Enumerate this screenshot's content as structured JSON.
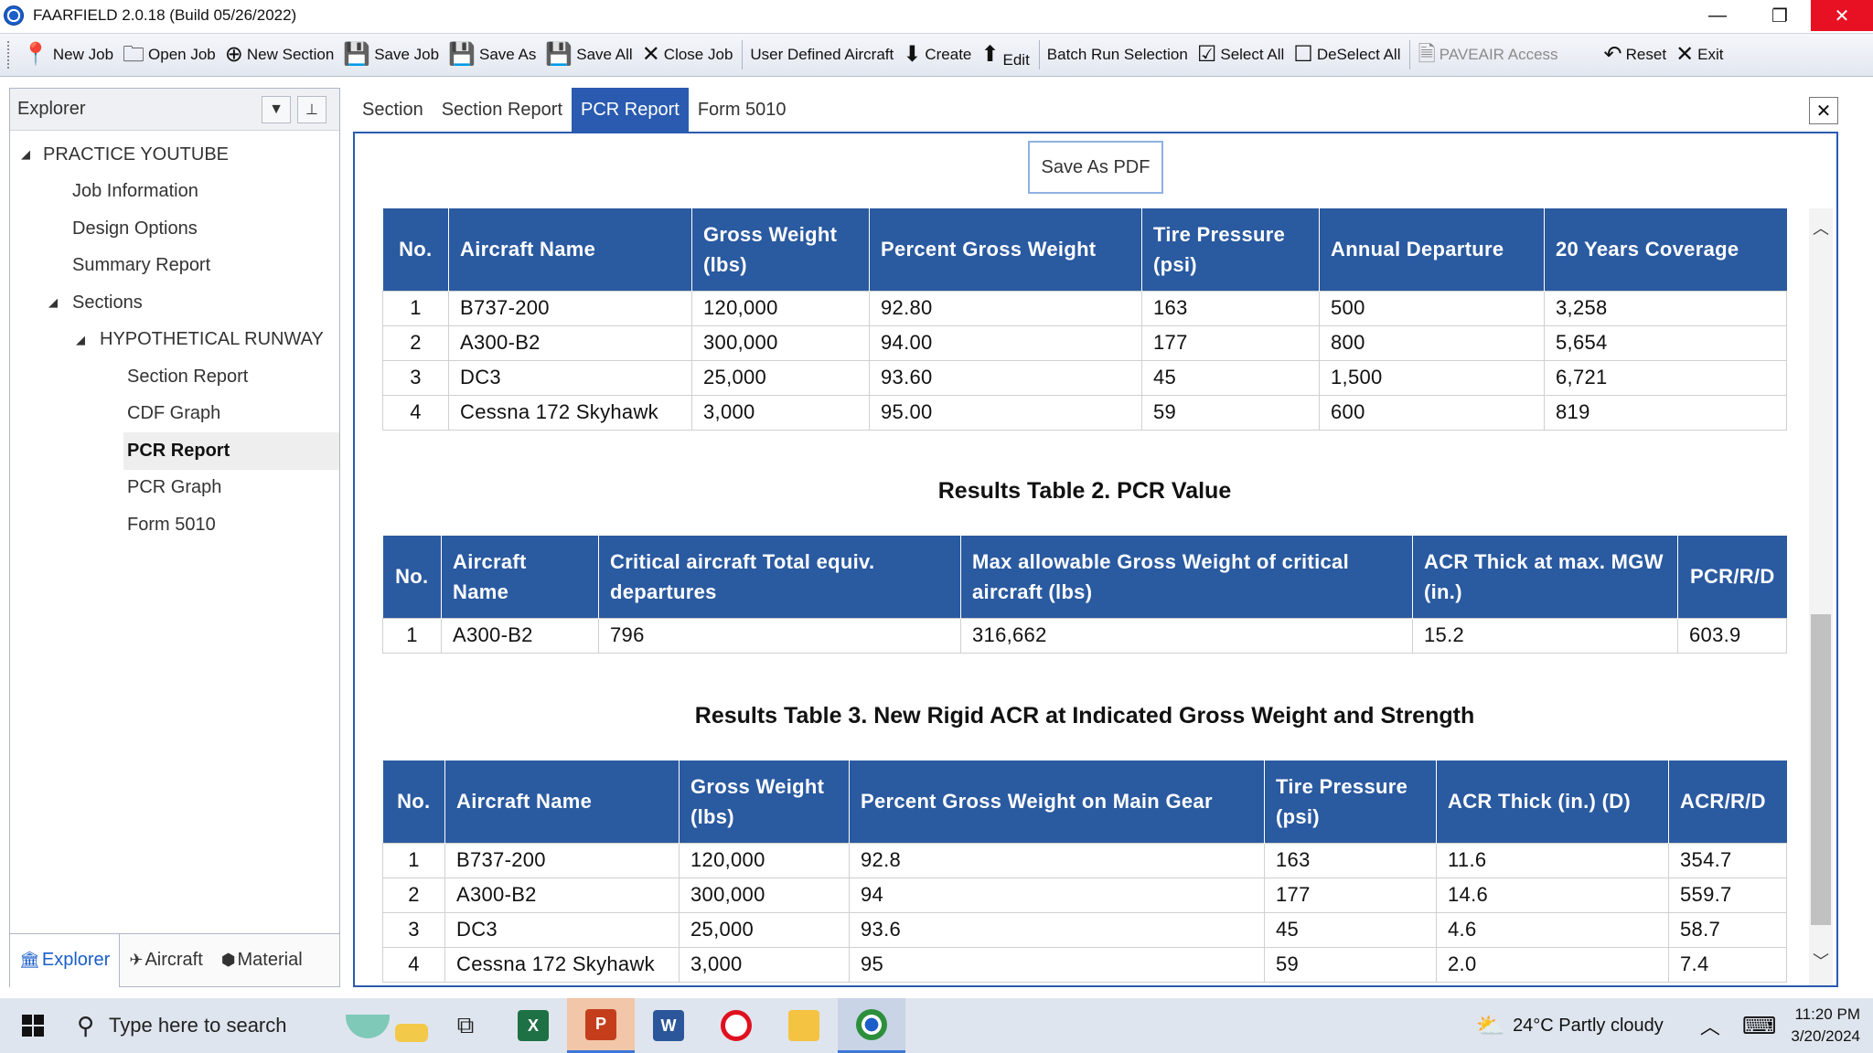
{
  "window": {
    "title": "FAARFIELD 2.0.18 (Build 05/26/2022)",
    "minimize": "—",
    "restore": "❐",
    "close": "✕"
  },
  "toolbar": {
    "new_job": "New Job",
    "open_job": "Open Job",
    "new_section": "New Section",
    "save_job": "Save Job",
    "save_as": "Save As",
    "save_all": "Save All",
    "close_job": "Close Job",
    "user_defined_aircraft": "User Defined Aircraft",
    "create": "Create",
    "edit": "Edit",
    "batch_run_selection": "Batch Run Selection",
    "select_all": "Select All",
    "deselect_all": "DeSelect All",
    "paveair_access": "PAVEAIR Access",
    "reset": "Reset",
    "exit": "Exit"
  },
  "explorer": {
    "title": "Explorer",
    "tree": {
      "root": "PRACTICE YOUTUBE",
      "job_information": "Job Information",
      "design_options": "Design Options",
      "summary_report": "Summary Report",
      "sections": "Sections",
      "runway": "HYPOTHETICAL RUNWAY",
      "section_report": "Section Report",
      "cdf_graph": "CDF Graph",
      "pcr_report": "PCR Report",
      "pcr_graph": "PCR Graph",
      "form_5010": "Form 5010"
    },
    "bottom_tabs": {
      "explorer": "Explorer",
      "aircraft": "Aircraft",
      "material": "Material"
    }
  },
  "tabs": {
    "section": "Section",
    "section_report": "Section Report",
    "pcr_report": "PCR Report",
    "form_5010": "Form 5010"
  },
  "report": {
    "save_pdf": "Save As PDF",
    "table1": {
      "headers": [
        "No.",
        "Aircraft Name",
        "Gross Weight (lbs)",
        "Percent Gross Weight",
        "Tire Pressure (psi)",
        "Annual Departure",
        "20 Years Coverage"
      ],
      "rows": [
        [
          "1",
          "B737-200",
          "120,000",
          "92.80",
          "163",
          "500",
          "3,258"
        ],
        [
          "2",
          "A300-B2",
          "300,000",
          "94.00",
          "177",
          "800",
          "5,654"
        ],
        [
          "3",
          "DC3",
          "25,000",
          "93.60",
          "45",
          "1,500",
          "6,721"
        ],
        [
          "4",
          "Cessna 172 Skyhawk",
          "3,000",
          "95.00",
          "59",
          "600",
          "819"
        ]
      ]
    },
    "table2": {
      "title": "Results Table 2. PCR Value",
      "headers": [
        "No.",
        "Aircraft Name",
        "Critical aircraft Total equiv. departures",
        "Max allowable Gross Weight of critical aircraft (lbs)",
        "ACR Thick at max. MGW (in.)",
        "PCR/R/D"
      ],
      "rows": [
        [
          "1",
          "A300-B2",
          "796",
          "316,662",
          "15.2",
          "603.9"
        ]
      ]
    },
    "table3": {
      "title": "Results Table 3. New Rigid ACR at Indicated Gross Weight and Strength",
      "headers": [
        "No.",
        "Aircraft Name",
        "Gross Weight (lbs)",
        "Percent Gross Weight on Main Gear",
        "Tire Pressure (psi)",
        "ACR Thick (in.) (D)",
        "ACR/R/D"
      ],
      "rows": [
        [
          "1",
          "B737-200",
          "120,000",
          "92.8",
          "163",
          "11.6",
          "354.7"
        ],
        [
          "2",
          "A300-B2",
          "300,000",
          "94",
          "177",
          "14.6",
          "559.7"
        ],
        [
          "3",
          "DC3",
          "25,000",
          "93.6",
          "45",
          "4.6",
          "58.7"
        ],
        [
          "4",
          "Cessna 172 Skyhawk",
          "3,000",
          "95",
          "59",
          "2.0",
          "7.4"
        ]
      ]
    }
  },
  "taskbar": {
    "search_placeholder": "Type here to search",
    "weather": "24°C  Partly cloudy",
    "time": "11:20 PM",
    "date": "3/20/2024"
  }
}
